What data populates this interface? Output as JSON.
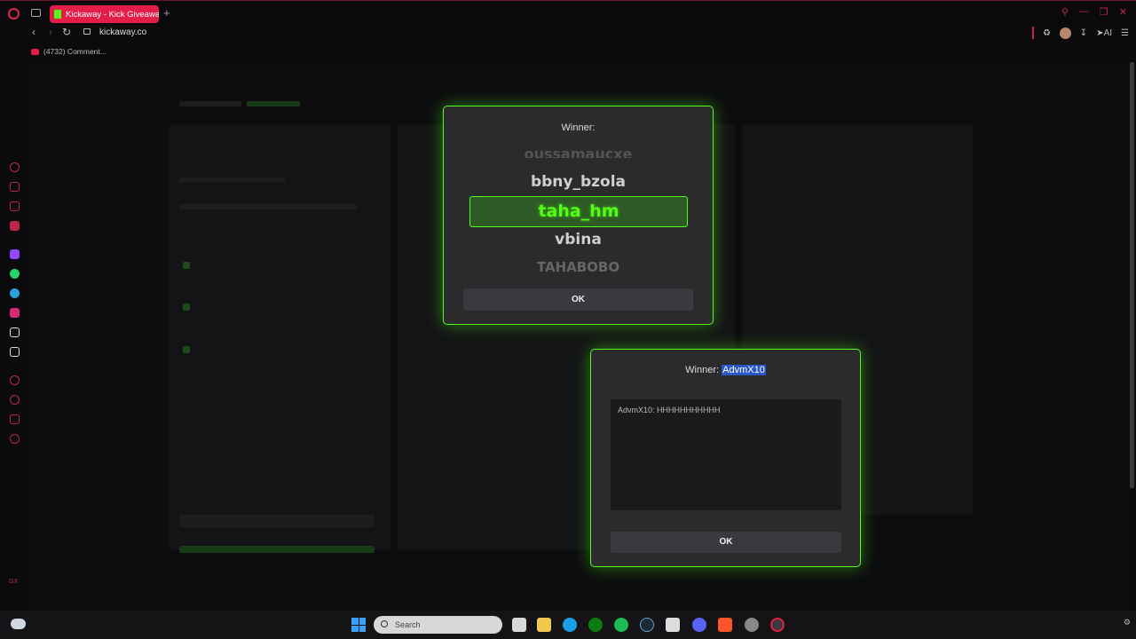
{
  "browser": {
    "tab_title": "Kickaway - Kick Giveaway",
    "new_tab": "+",
    "url": "kickaway.co",
    "bookmark": "(4732) Comment...",
    "ai_label": "AI",
    "sidebar_bottom_label": "GX"
  },
  "modal_winner_reel": {
    "title": "Winner:",
    "items_above_faded": "oussamaucxe",
    "item_above": "bbny_bzola",
    "selected": "taha_hm",
    "item_below": "vbina",
    "items_below_faded": "TAHABOBO",
    "ok_label": "OK"
  },
  "modal_winner_chat": {
    "title_prefix": "Winner:",
    "winner_name": "AdvmX10",
    "chat_message": "AdvmX10: HHHHHHHHHHH",
    "ok_label": "OK"
  },
  "taskbar": {
    "search_placeholder": "Search"
  },
  "colors": {
    "accent_green": "#53fc18",
    "opera_red": "#e11d48"
  }
}
